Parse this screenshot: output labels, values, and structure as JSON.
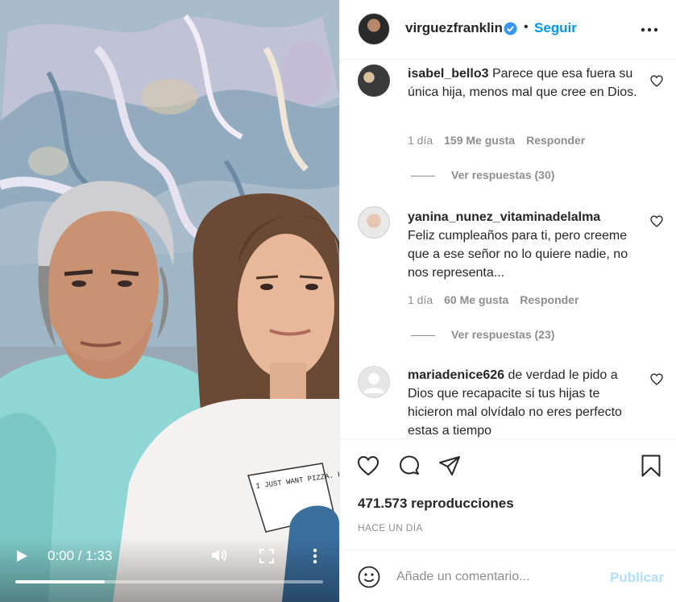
{
  "video": {
    "time": "0:00 / 1:33",
    "progress": 0.29,
    "icons": [
      "play-icon",
      "volume-icon",
      "fullscreen-icon",
      "more-vertical-icon"
    ],
    "shirt_text": "I JUST WANT PIZZA. PIZZA UNDERSTANDS ME..."
  },
  "header": {
    "username": "virguezfranklin",
    "dot": "•",
    "follow_label": "Seguir",
    "icons": [
      "verified-badge-icon",
      "more-options-icon"
    ]
  },
  "comments": [
    {
      "username": "isabel_bello3",
      "text": "Parece que esa fuera su única hija, menos mal que cree en Dios.",
      "age": "1 día",
      "likes": "159 Me gusta",
      "reply": "Responder",
      "replies": "Ver respuestas (30)"
    },
    {
      "username": "yanina_nunez_vitaminadelalma",
      "text": "Feliz cumpleaños para ti, pero creeme que a ese señor no lo quiere nadie, no nos representa...",
      "age": "1 día",
      "likes": "60 Me gusta",
      "reply": "Responder",
      "replies": "Ver respuestas (23)"
    },
    {
      "username": "mariadenice626",
      "text": "de verdad le pido a Dios que recapacite si tus hijas te hicieron mal olvídalo no eres perfecto estas a tiempo",
      "age": "",
      "likes": "",
      "reply": "",
      "replies": ""
    }
  ],
  "actions": {
    "icons": [
      "heart-icon",
      "comment-icon",
      "share-icon",
      "bookmark-icon"
    ],
    "views": "471.573 reproducciones",
    "posted": "HACE UN DÍA"
  },
  "composer": {
    "placeholder": "Añade un comentario...",
    "post_label": "Publicar",
    "icon": "emoji-icon"
  },
  "colors": {
    "link_blue": "#0095f6",
    "post_disabled": "#b2dffc",
    "secondary_text": "#8e8e8e",
    "border": "#efefef"
  }
}
